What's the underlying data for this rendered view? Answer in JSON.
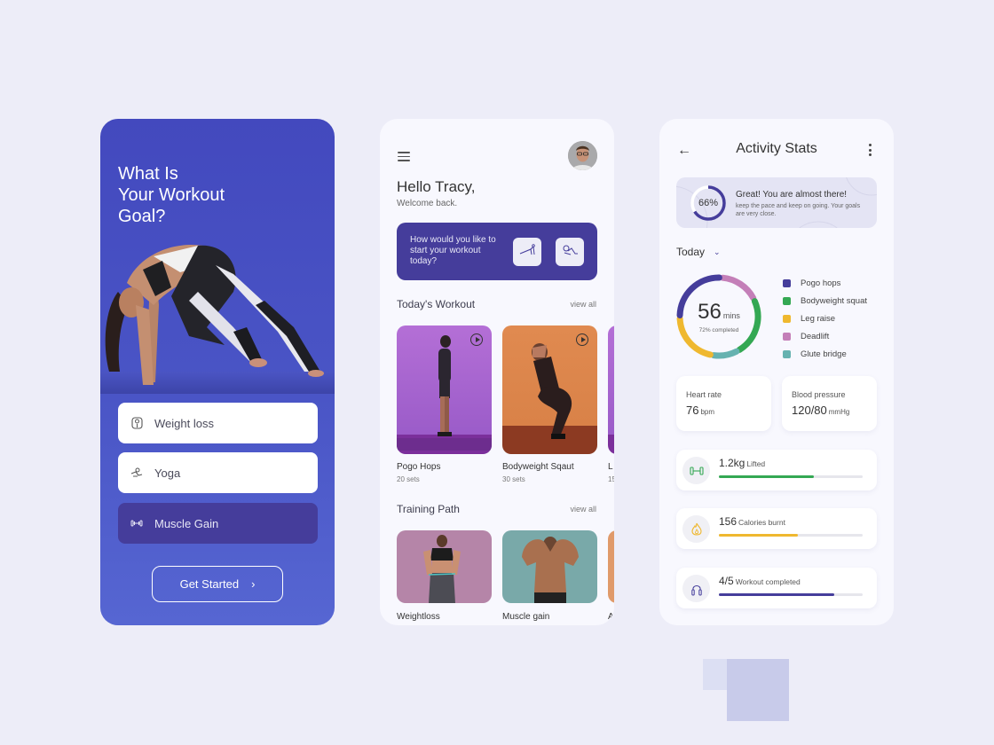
{
  "colors": {
    "background": "#ededf8",
    "brand_blue": "#4a55c6",
    "brand_purple": "#453d9b",
    "pogo_hops": "#453d9b",
    "bodyweight_squat": "#34a853",
    "leg_raise": "#efb82f",
    "deadlift": "#c47fb8",
    "glute_bridge": "#66b2b0"
  },
  "goal_screen": {
    "title_lines": [
      "What Is",
      "Your Workout",
      "Goal?"
    ],
    "options": [
      {
        "label": "Weight loss",
        "icon": "scale-icon",
        "selected": false
      },
      {
        "label": "Yoga",
        "icon": "yoga-icon",
        "selected": false
      },
      {
        "label": "Muscle Gain",
        "icon": "dumbbell-icon",
        "selected": true
      }
    ],
    "cta_label": "Get Started",
    "cta_icon": "chevron-right-icon"
  },
  "home_screen": {
    "greeting": "Hello Tracy,",
    "subtitle": "Welcome back.",
    "promo_text": "How would you like to start your workout today?",
    "promo_options": [
      {
        "icon": "pushup-icon"
      },
      {
        "icon": "situp-icon"
      }
    ],
    "todays_workout": {
      "title": "Today's Workout",
      "view_all": "view all",
      "items": [
        {
          "name": "Pogo Hops",
          "sets": "20 sets"
        },
        {
          "name": "Bodyweight Sqaut",
          "sets": "30 sets"
        },
        {
          "name": "L",
          "sets": "15"
        }
      ]
    },
    "training_path": {
      "title": "Training Path",
      "view_all": "view all",
      "items": [
        {
          "name": "Weightloss"
        },
        {
          "name": "Muscle gain"
        },
        {
          "name": "A"
        }
      ]
    }
  },
  "stats_screen": {
    "title": "Activity Stats",
    "banner": {
      "percent_label": "66%",
      "percent_value": 66,
      "headline": "Great! You are almost there!",
      "message": "keep the pace and keep on going. Your goals are very close."
    },
    "period": "Today",
    "summary": {
      "value": "56",
      "unit": "mins",
      "completed": "72% completed"
    },
    "legend": [
      {
        "label": "Pogo hops",
        "color": "#453d9b"
      },
      {
        "label": "Bodyweight squat",
        "color": "#34a853"
      },
      {
        "label": "Leg raise",
        "color": "#efb82f"
      },
      {
        "label": "Deadlift",
        "color": "#c47fb8"
      },
      {
        "label": "Glute bridge",
        "color": "#66b2b0"
      }
    ],
    "vitals": [
      {
        "label": "Heart rate",
        "value": "76",
        "unit": "bpm"
      },
      {
        "label": "Blood pressure",
        "value": "120/80",
        "unit": "mmHg"
      }
    ],
    "progress": [
      {
        "value": "1.2kg",
        "label": "Lifted",
        "fraction": 0.66,
        "color": "#34a853",
        "icon": "dumbbell-icon"
      },
      {
        "value": "156",
        "label": "Calories burnt",
        "fraction": 0.55,
        "color": "#efb82f",
        "icon": "flame-icon"
      },
      {
        "value": "4/5",
        "label": "Workout completed",
        "fraction": 0.8,
        "color": "#453d9b",
        "icon": "jump-rope-icon"
      }
    ]
  },
  "chart_data": {
    "type": "pie",
    "title": "Today",
    "center_label": "56 mins",
    "center_sublabel": "72% completed",
    "categories": [
      "Deadlift",
      "Bodyweight squat",
      "Glute bridge",
      "Leg raise",
      "Pogo hops"
    ],
    "values": [
      17,
      24,
      11,
      22,
      26
    ],
    "colors": [
      "#c47fb8",
      "#34a853",
      "#66b2b0",
      "#efb82f",
      "#453d9b"
    ],
    "legend": "right"
  }
}
